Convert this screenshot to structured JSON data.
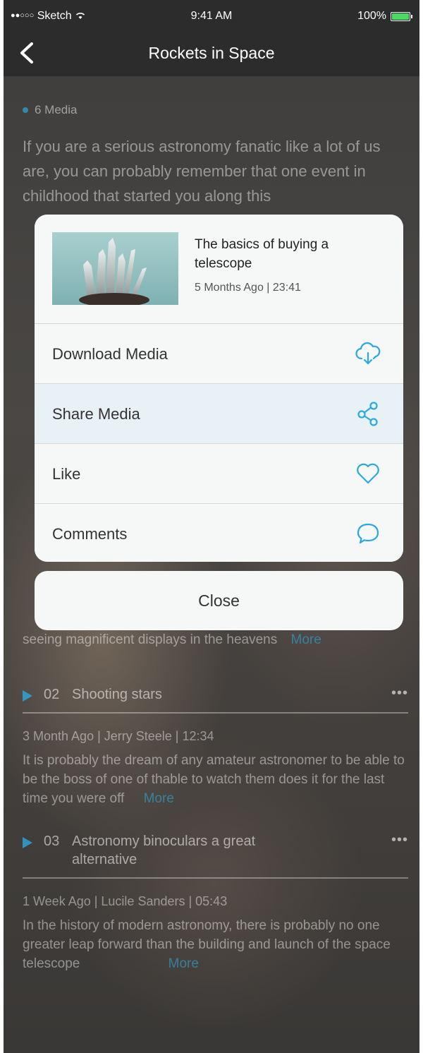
{
  "status_bar": {
    "signal": "●●○○○",
    "carrier": "Sketch",
    "time": "9:41 AM",
    "battery": "100%"
  },
  "nav": {
    "title": "Rockets in Space",
    "back_icon": "chevron-left-icon"
  },
  "background": {
    "media_count": "6 Media",
    "intro": "If you are a serious astronomy fanatic like a lot of us are, you can probably remember that one event in childhood that started you along this",
    "tracks": [
      {
        "number": "02",
        "title": "Shooting stars",
        "meta": "3 Month Ago | Jerry Steele | 12:34",
        "desc": "It is probably the dream of any amateur astronomer to be able to be the boss of one of thable to watch them does it for the last time you were off",
        "more": "More"
      },
      {
        "number": "03",
        "title": "Astronomy binoculars a great alternative",
        "meta": "1 Week Ago | Lucile Sanders | 05:43",
        "desc": "In the history of modern astronomy, there is probably no one greater leap forward than the building and launch of the space telescope",
        "more": "More"
      }
    ],
    "partial_line": "seeing magnificent displays in the heavens",
    "partial_more": "More",
    "overflow_label": "•••"
  },
  "sheet": {
    "media_title": "The basics of buying a telescope",
    "media_meta": "5 Months Ago | 23:41",
    "actions": [
      {
        "label": "Download Media",
        "icon": "cloud-download-icon"
      },
      {
        "label": "Share Media",
        "icon": "share-icon"
      },
      {
        "label": "Like",
        "icon": "heart-icon"
      },
      {
        "label": "Comments",
        "icon": "comment-icon"
      }
    ],
    "close_label": "Close"
  },
  "colors": {
    "accent": "#2aa9e0",
    "sheet_bg": "#f6f7f7",
    "highlight_row": "#e8f1f6"
  }
}
